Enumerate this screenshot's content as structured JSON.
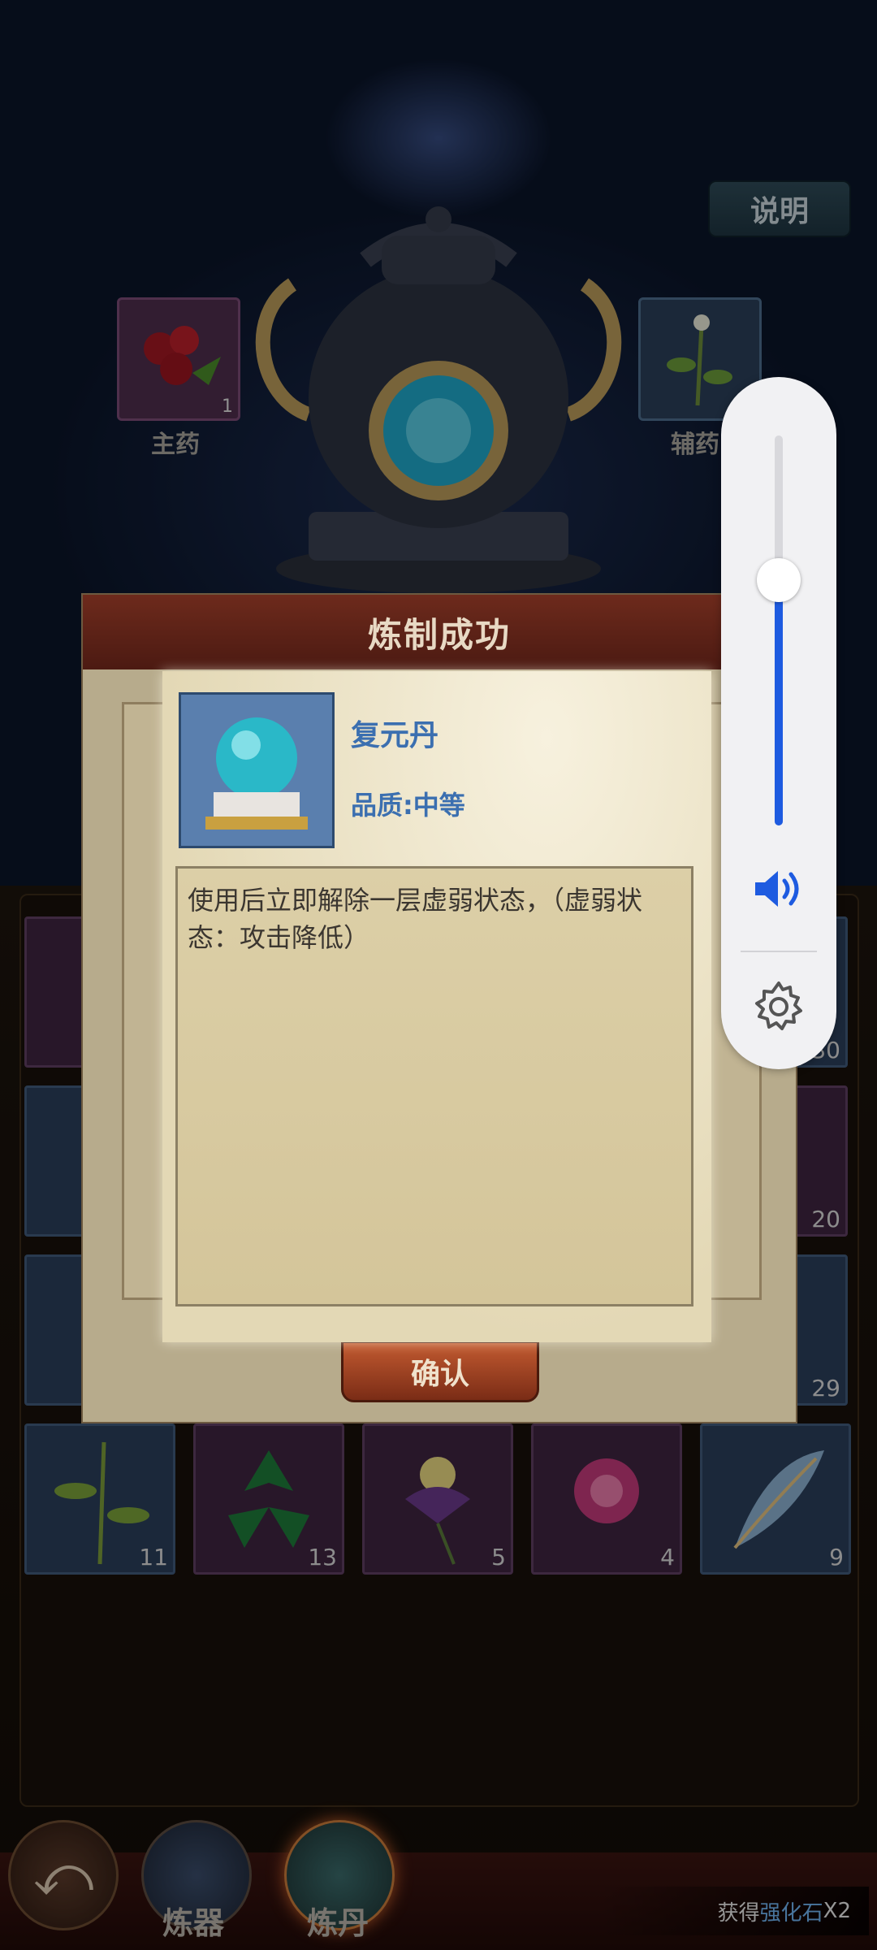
{
  "header": {
    "help_label": "说明"
  },
  "slots": {
    "main": {
      "label": "主药",
      "count": "1"
    },
    "aux": {
      "label": "辅药"
    }
  },
  "inventory": {
    "rows": [
      {
        "counts": [
          "",
          "",
          "",
          "",
          "30"
        ]
      },
      {
        "counts": [
          "",
          "",
          "",
          "",
          "20"
        ]
      },
      {
        "counts": [
          "",
          "",
          "",
          "",
          "29"
        ]
      },
      {
        "counts": [
          "11",
          "13",
          "5",
          "4",
          "9"
        ]
      }
    ]
  },
  "dialog": {
    "title": "炼制成功",
    "confirm_label": "确认",
    "item": {
      "name": "复元丹",
      "quality": "品质:中等",
      "description": "使用后立即解除一层虚弱状态，（虚弱状态：攻击降低）"
    }
  },
  "bottom_nav": {
    "tabs": [
      {
        "label": "炼器"
      },
      {
        "label": "炼丹"
      }
    ],
    "toast_prefix": "获得",
    "toast_item": "强化石",
    "toast_suffix": "X2"
  },
  "volume": {
    "level_percent": 63
  },
  "colors": {
    "accent": "#1e5be0",
    "quality_text": "#3b6fb0",
    "dialog_header": "#6d2a1c"
  }
}
